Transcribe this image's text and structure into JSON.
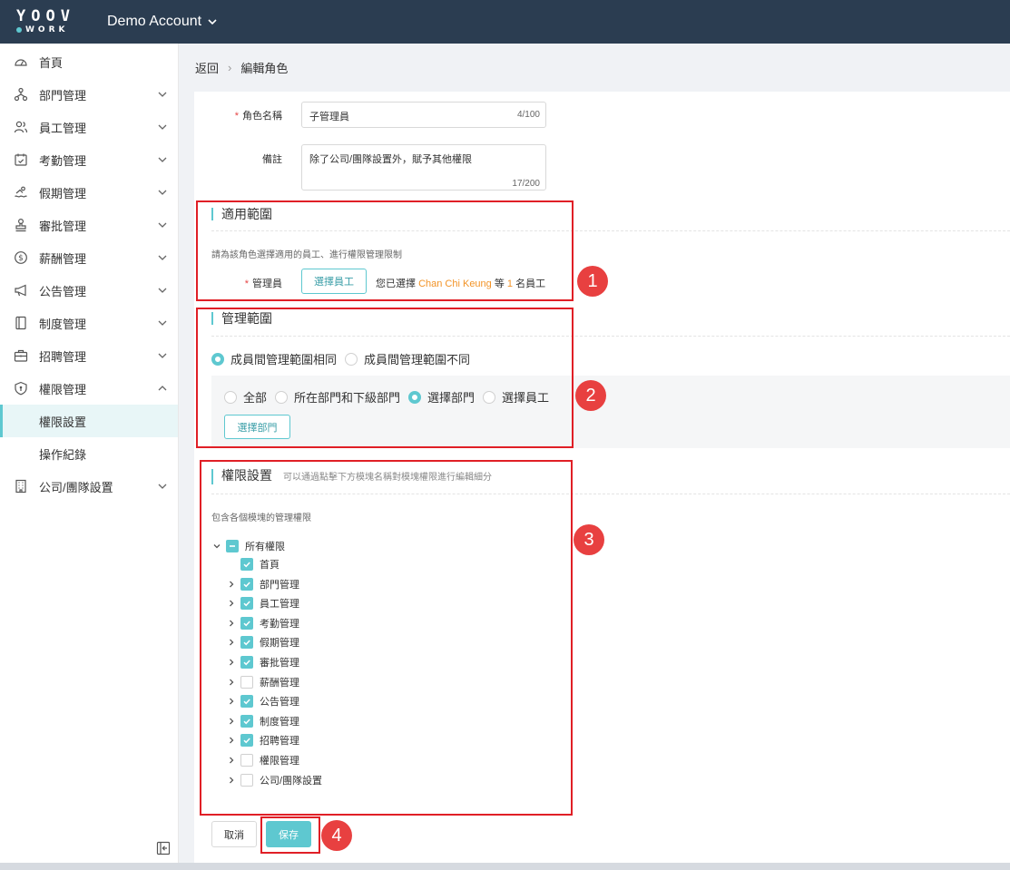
{
  "app": {
    "logo_top": "YOOV",
    "logo_bottom": "WORK",
    "account_name": "Demo Account"
  },
  "sidebar": {
    "items": [
      {
        "label": "首頁"
      },
      {
        "label": "部門管理"
      },
      {
        "label": "員工管理"
      },
      {
        "label": "考勤管理"
      },
      {
        "label": "假期管理"
      },
      {
        "label": "審批管理"
      },
      {
        "label": "薪酬管理"
      },
      {
        "label": "公告管理"
      },
      {
        "label": "制度管理"
      },
      {
        "label": "招聘管理"
      },
      {
        "label": "權限管理"
      }
    ],
    "sub_items": [
      {
        "label": "權限設置"
      },
      {
        "label": "操作紀錄"
      }
    ],
    "last_item": {
      "label": "公司/團隊設置"
    }
  },
  "breadcrumb": {
    "back": "返回",
    "separator": "›",
    "current": "編輯角色"
  },
  "form": {
    "role_name_label": "角色名稱",
    "role_name_value": "子管理員",
    "role_name_counter": "4/100",
    "notes_label": "備註",
    "notes_value": "除了公司/團隊設置外，賦予其他權限",
    "notes_counter": "17/200"
  },
  "scope": {
    "title": "適用範圍",
    "desc": "請為該角色選擇適用的員工、進行權限管理限制",
    "admin_label": "管理員",
    "select_button": "選擇員工",
    "selected_prefix": "您已選擇",
    "selected_name": "Chan Chi Keung",
    "selected_mid": "等",
    "selected_count": "1",
    "selected_suffix": "名員工"
  },
  "manage_scope": {
    "title": "管理範圍",
    "option_same": "成員間管理範圍相同",
    "option_diff": "成員間管理範圍不同",
    "option_all": "全部",
    "option_dept_sub": "所在部門和下級部門",
    "option_select_dept": "選擇部門",
    "option_select_staff": "選擇員工",
    "select_dept_button": "選擇部門"
  },
  "permissions": {
    "title": "權限設置",
    "subtitle": "可以通過點擊下方模塊名稱對模塊權限進行編輯細分",
    "desc": "包含各個模塊的管理權限",
    "root_label": "所有權限",
    "modules": [
      {
        "label": "首頁",
        "checked": true,
        "expandable": false
      },
      {
        "label": "部門管理",
        "checked": true,
        "expandable": true
      },
      {
        "label": "員工管理",
        "checked": true,
        "expandable": true
      },
      {
        "label": "考勤管理",
        "checked": true,
        "expandable": true
      },
      {
        "label": "假期管理",
        "checked": true,
        "expandable": true
      },
      {
        "label": "審批管理",
        "checked": true,
        "expandable": true
      },
      {
        "label": "薪酬管理",
        "checked": false,
        "expandable": true
      },
      {
        "label": "公告管理",
        "checked": true,
        "expandable": true
      },
      {
        "label": "制度管理",
        "checked": true,
        "expandable": true
      },
      {
        "label": "招聘管理",
        "checked": true,
        "expandable": true
      },
      {
        "label": "權限管理",
        "checked": false,
        "expandable": true
      },
      {
        "label": "公司/團隊設置",
        "checked": false,
        "expandable": true
      }
    ]
  },
  "actions": {
    "cancel": "取消",
    "save": "保存"
  },
  "annotations": {
    "badge1": "1",
    "badge2": "2",
    "badge3": "3",
    "badge4": "4"
  },
  "colors": {
    "accent": "#5ec8d0",
    "topbar": "#2b3d51",
    "highlight": "#e01f26",
    "badge": "#e84040",
    "selected_name": "#f29326"
  }
}
